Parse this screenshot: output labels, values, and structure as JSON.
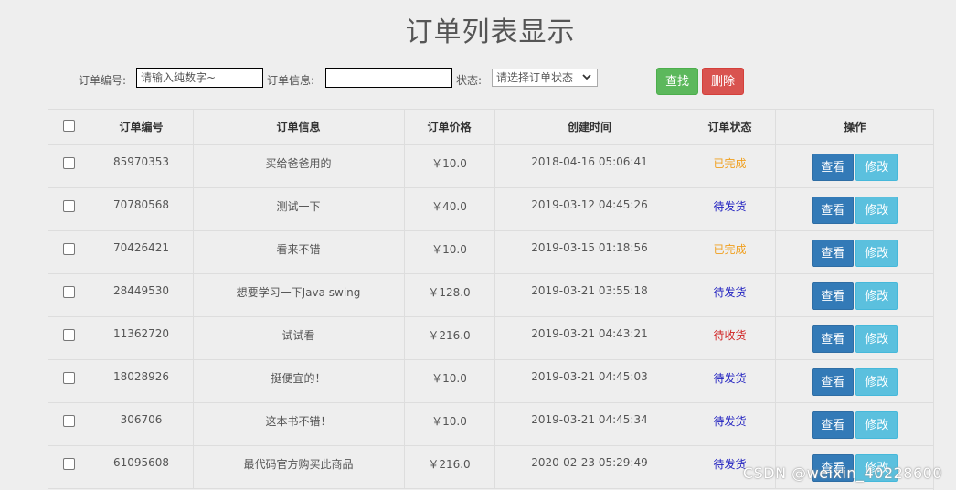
{
  "title": "订单列表显示",
  "filters": {
    "order_no_label": "订单编号:",
    "order_no_placeholder": "请输入纯数字~",
    "order_info_label": "订单信息:",
    "order_info_value": "",
    "status_label": "状态:",
    "status_selected": "请选择订单状态",
    "search_label": "查找",
    "delete_label": "删除"
  },
  "table": {
    "headers": [
      "订单编号",
      "订单信息",
      "订单价格",
      "创建时间",
      "订单状态",
      "操作"
    ],
    "view_label": "查看",
    "edit_label": "修改",
    "rows": [
      {
        "id": "85970353",
        "info": "买给爸爸用的",
        "price": "￥10.0",
        "time": "2018-04-16 05:06:41",
        "status": "已完成",
        "status_type": "done"
      },
      {
        "id": "70780568",
        "info": "测试一下",
        "price": "￥40.0",
        "time": "2019-03-12 04:45:26",
        "status": "待发货",
        "status_type": "ship"
      },
      {
        "id": "70426421",
        "info": "看来不错",
        "price": "￥10.0",
        "time": "2019-03-15 01:18:56",
        "status": "已完成",
        "status_type": "done"
      },
      {
        "id": "28449530",
        "info": "想要学习一下Java swing",
        "price": "￥128.0",
        "time": "2019-03-21 03:55:18",
        "status": "待发货",
        "status_type": "ship"
      },
      {
        "id": "11362720",
        "info": "试试看",
        "price": "￥216.0",
        "time": "2019-03-21 04:43:21",
        "status": "待收货",
        "status_type": "recv"
      },
      {
        "id": "18028926",
        "info": "挺便宜的！",
        "price": "￥10.0",
        "time": "2019-03-21 04:45:03",
        "status": "待发货",
        "status_type": "ship"
      },
      {
        "id": "306706",
        "info": "这本书不错！",
        "price": "￥10.0",
        "time": "2019-03-21 04:45:34",
        "status": "待发货",
        "status_type": "ship"
      },
      {
        "id": "61095608",
        "info": "最代码官方购买此商品",
        "price": "￥216.0",
        "time": "2020-02-23 05:29:49",
        "status": "待发货",
        "status_type": "ship"
      }
    ]
  },
  "watermark": "CSDN @weixin_40228600",
  "colors": {
    "search_button": "#5cb85c",
    "delete_button": "#d9534f",
    "view_button": "#337ab7",
    "edit_button": "#5bc0de",
    "status_done": "#f0a020",
    "status_ship": "#2020c0",
    "status_recv": "#d02020"
  }
}
